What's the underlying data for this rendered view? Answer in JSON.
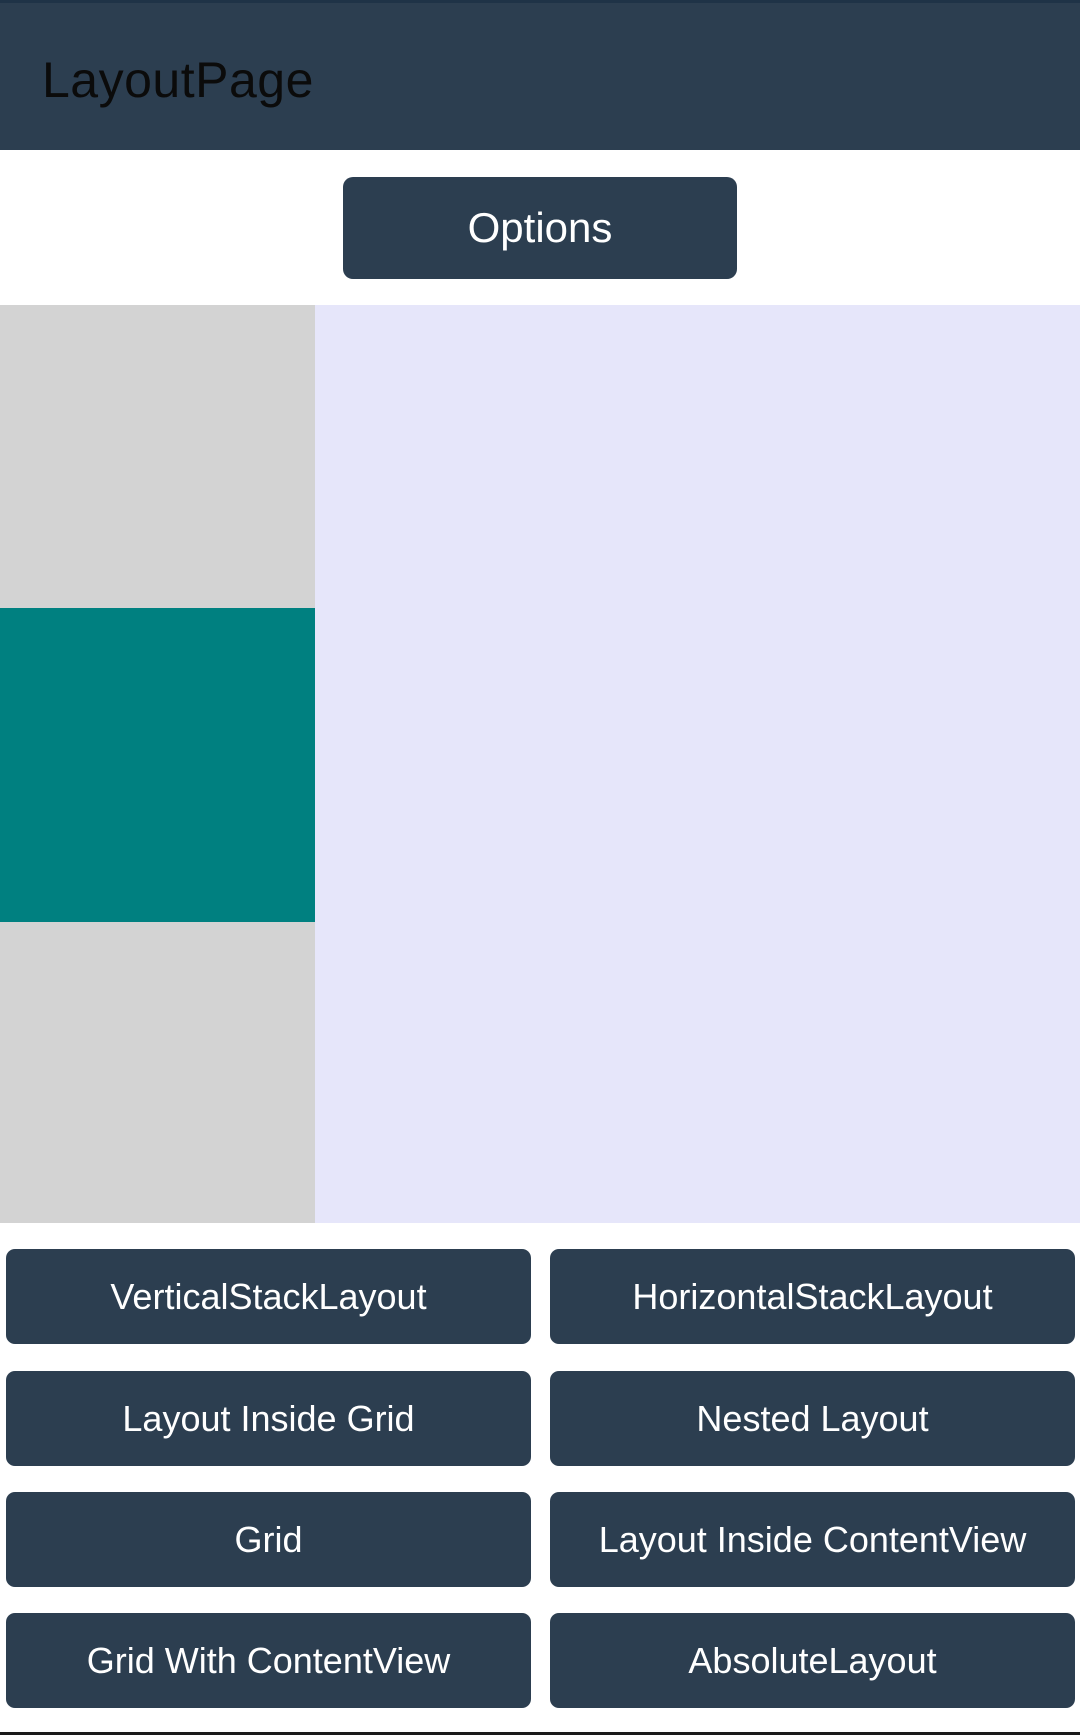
{
  "app_bar": {
    "title": "LayoutPage"
  },
  "options_button": {
    "label": "Options"
  },
  "buttons": [
    "VerticalStackLayout",
    "HorizontalStackLayout",
    "Layout Inside Grid",
    "Nested Layout",
    "Grid",
    "Layout Inside ContentView",
    "Grid With ContentView",
    "AbsoluteLayout"
  ],
  "colors": {
    "accent": "#2c3e50",
    "left_column": "#d3d3d3",
    "highlight_box": "#008080",
    "right_area": "#e6e6fa"
  }
}
